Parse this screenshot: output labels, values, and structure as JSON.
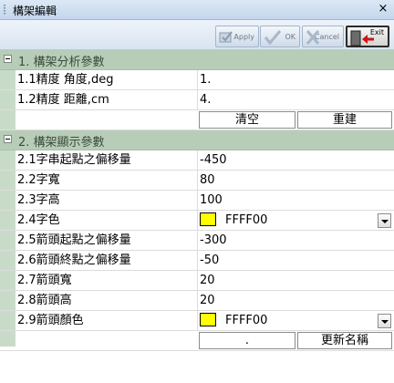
{
  "window": {
    "title": "構架編輯",
    "close_glyph": "×"
  },
  "toolbar": {
    "apply_label": "Apply",
    "ok_label": "OK",
    "cancel_label": "Cancel",
    "exit_label": "Exit"
  },
  "sections": [
    {
      "label": "1. 構架分析參數",
      "rows": [
        {
          "name": "1.1精度 角度,deg",
          "value": "1."
        },
        {
          "name": "1.2精度 距離,cm",
          "value": "4."
        }
      ],
      "buttons": [
        "清空",
        "重建"
      ]
    },
    {
      "label": "2. 構架顯示參數",
      "rows": [
        {
          "name": "2.1字串起點之偏移量",
          "value": "-450"
        },
        {
          "name": "2.2字寬",
          "value": "80"
        },
        {
          "name": "2.3字高",
          "value": "100"
        },
        {
          "name": "2.4字色",
          "value": "FFFF00"
        },
        {
          "name": "2.5箭頭起點之偏移量",
          "value": "-300"
        },
        {
          "name": "2.6箭頭終點之偏移量",
          "value": "-50"
        },
        {
          "name": "2.7箭頭寬",
          "value": "20"
        },
        {
          "name": "2.8箭頭高",
          "value": "20"
        },
        {
          "name": "2.9箭頭顏色",
          "value": "FFFF00"
        }
      ],
      "buttons": [
        ".",
        "更新名稱"
      ]
    }
  ],
  "colors": {
    "text_color": "#FFFF00",
    "arrow_color": "#FFFF00"
  }
}
